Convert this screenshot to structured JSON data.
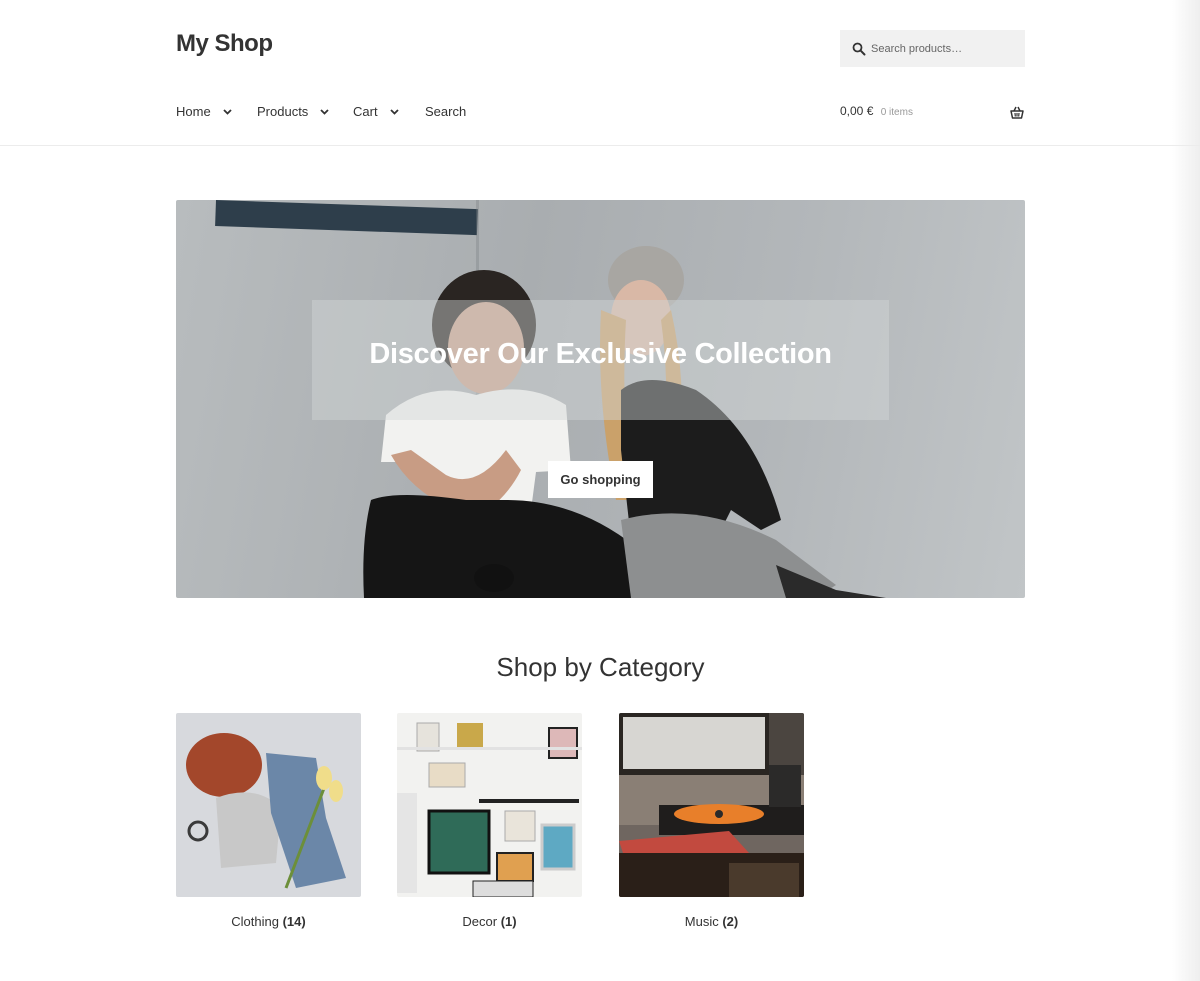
{
  "header": {
    "site_title": "My Shop",
    "search_placeholder": "Search products…"
  },
  "nav": {
    "items": [
      {
        "label": "Home",
        "has_dropdown": true
      },
      {
        "label": "Products",
        "has_dropdown": true
      },
      {
        "label": "Cart",
        "has_dropdown": true
      },
      {
        "label": "Search",
        "has_dropdown": false
      }
    ]
  },
  "cart": {
    "total": "0,00 €",
    "count": "0 items"
  },
  "hero": {
    "title": "Discover Our Exclusive Collection",
    "button_label": "Go shopping"
  },
  "categories": {
    "title": "Shop by Category",
    "items": [
      {
        "name": "Clothing",
        "count": "(14)"
      },
      {
        "name": "Decor",
        "count": "(1)"
      },
      {
        "name": "Music",
        "count": "(2)"
      }
    ]
  },
  "icons": {
    "search": "search-icon",
    "chevron": "chevron-down-icon",
    "basket": "basket-icon"
  },
  "colors": {
    "text": "#333333",
    "muted": "#999999",
    "search_bg": "#f1f1f1",
    "hero_overlay": "rgba(210,214,216,0.45)"
  }
}
